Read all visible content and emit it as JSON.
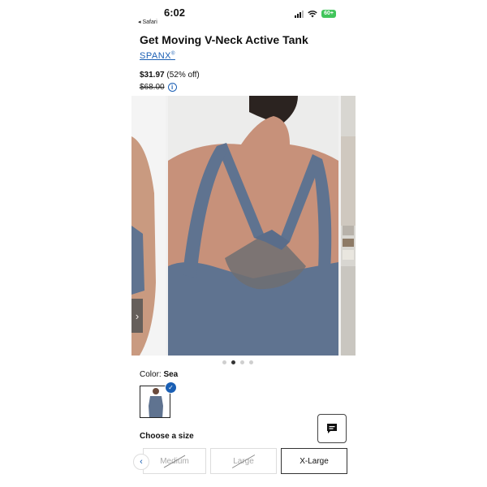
{
  "status_bar": {
    "time": "6:02",
    "back_app": "◂ Safari",
    "battery": "60+"
  },
  "product": {
    "title": "Get Moving V-Neck Active Tank",
    "brand": "SPANX",
    "brand_mark": "®",
    "price": "$31.97",
    "discount": "(52% off)",
    "original_price": "$68.00"
  },
  "gallery": {
    "image_count": 4,
    "active_index": 1
  },
  "color": {
    "label": "Color: ",
    "value": "Sea"
  },
  "size": {
    "label": "Choose a size",
    "options": [
      {
        "label": "Medium",
        "available": false
      },
      {
        "label": "Large",
        "available": false
      },
      {
        "label": "X-Large",
        "available": true,
        "selected": true
      }
    ]
  },
  "colors": {
    "accent": "#1a5fb4",
    "fabric": "#5f7390",
    "battery": "#41c55b"
  },
  "icons": [
    "signal-icon",
    "wifi-icon",
    "info-icon",
    "chevron-right-icon",
    "check-icon",
    "chat-icon",
    "chevron-left-icon"
  ]
}
